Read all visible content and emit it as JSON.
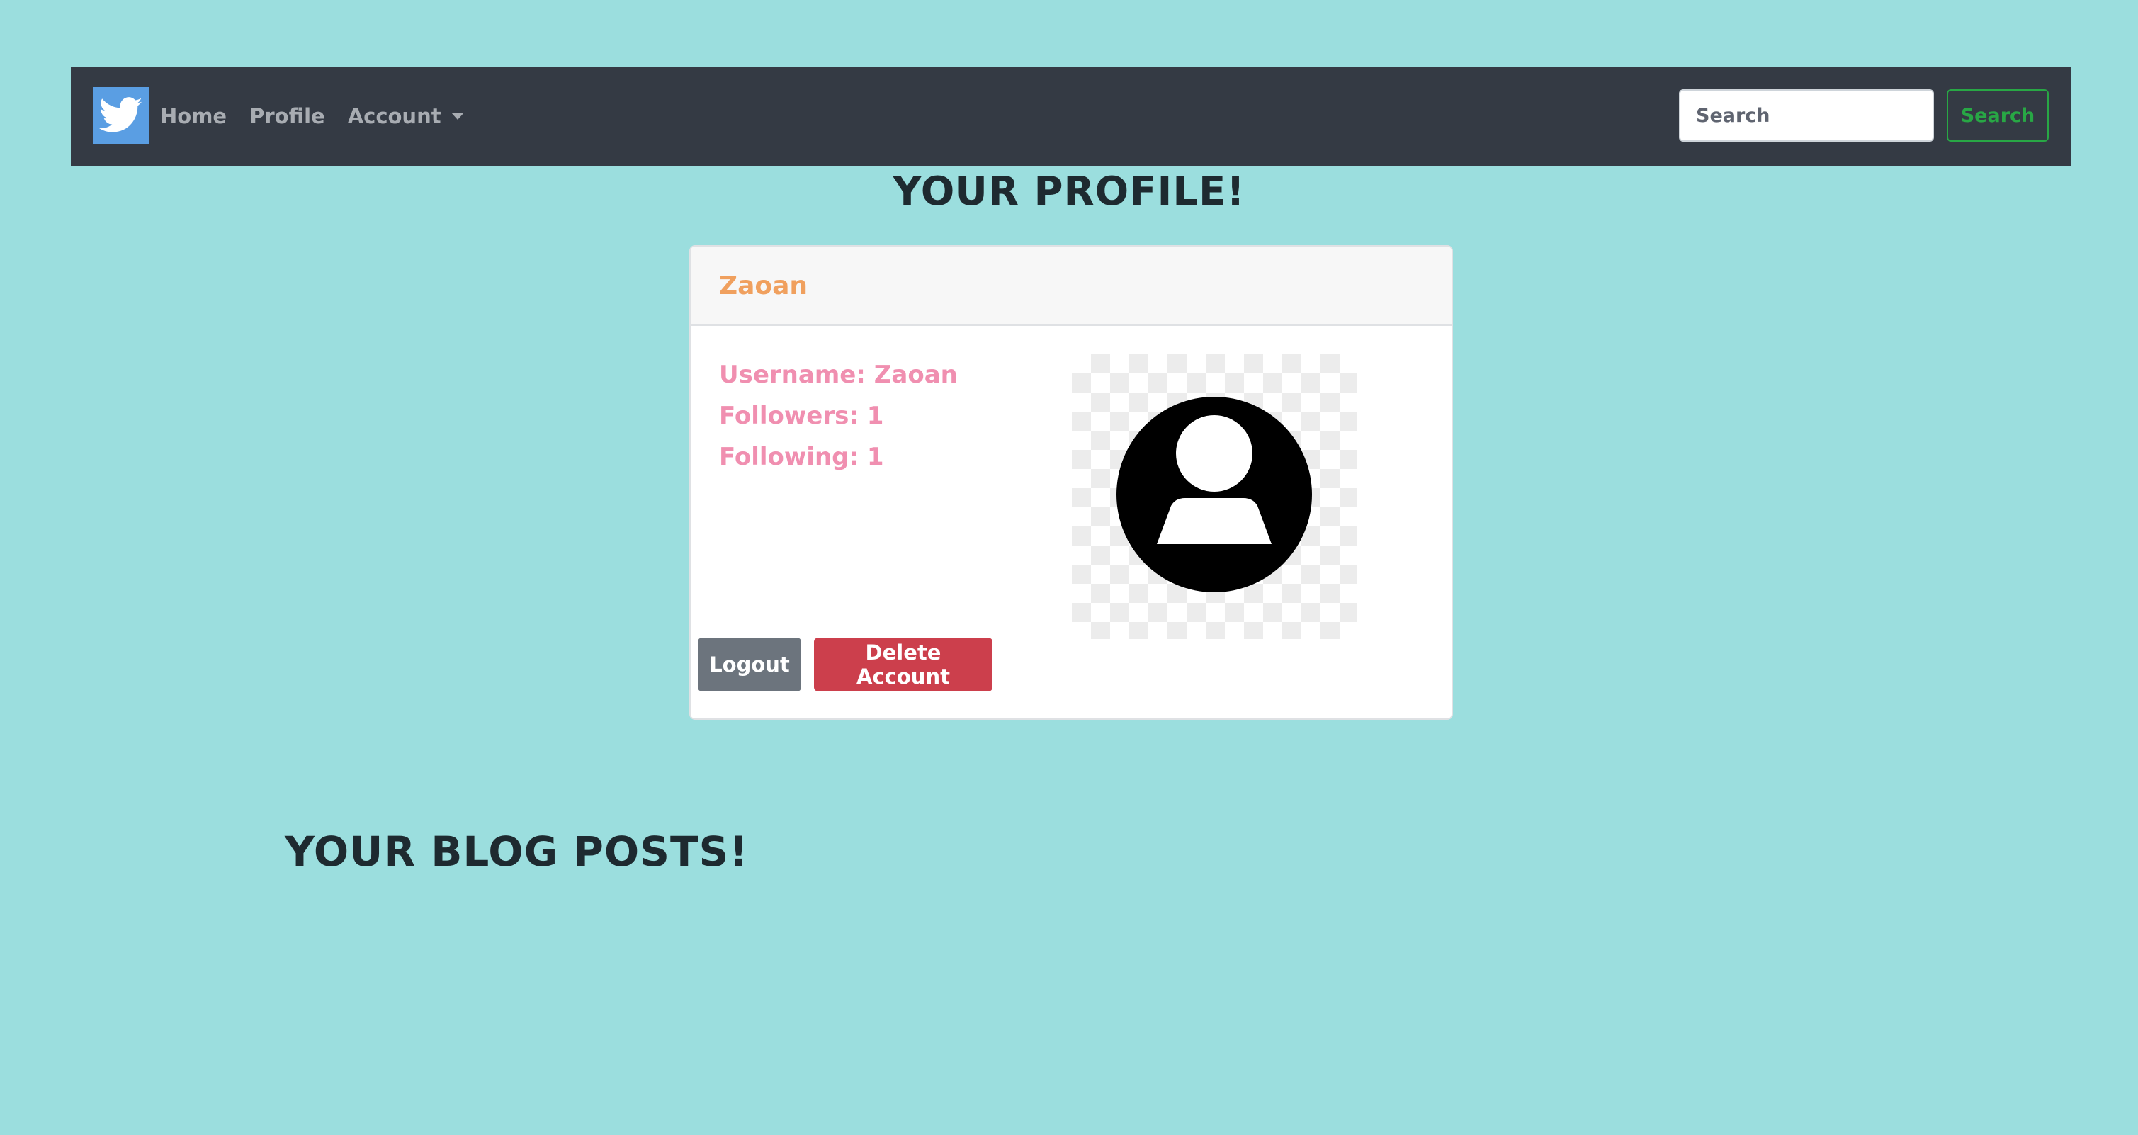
{
  "navbar": {
    "brand_icon": "twitter-bird-icon",
    "links": {
      "home": "Home",
      "profile": "Profile",
      "account": "Account"
    },
    "search": {
      "placeholder": "Search",
      "value": "",
      "button_label": "Search"
    }
  },
  "page": {
    "title": "YOUR PROFILE!",
    "posts_title": "YOUR BLOG POSTS!"
  },
  "profile": {
    "name": "Zaoan",
    "username_line": "Username: Zaoan",
    "followers_line": "Followers: 1",
    "following_line": "Following: 1",
    "avatar_icon": "default-user-avatar-icon",
    "logout_label": "Logout",
    "delete_label": "Delete Account"
  },
  "colors": {
    "background": "#9bdede",
    "navbar": "#343a44",
    "brand": "#5a9ee3",
    "search_button": "#28a745",
    "profile_name": "#f0a05e",
    "profile_info": "#f08fb0",
    "logout_button": "#6c747d",
    "delete_button": "#cc3f4c"
  }
}
